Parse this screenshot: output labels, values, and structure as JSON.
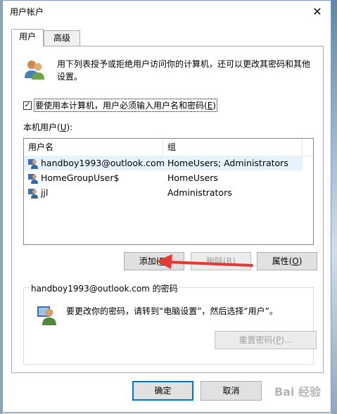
{
  "window": {
    "title": "用户帐户",
    "close_glyph": "✕"
  },
  "tabs": [
    {
      "label": "用户",
      "active": true
    },
    {
      "label": "高级",
      "active": false
    }
  ],
  "intro": {
    "text": "用下列表授予或拒绝用户访问你的计算机，还可以更改其密码和其他设置。"
  },
  "require_password": {
    "checked": true,
    "check_glyph": "✓",
    "label": "要使用本计算机，用户必须输入用户名和密码(",
    "mnemonic": "E",
    "label_end": ")"
  },
  "users_section": {
    "label": "本机用户(",
    "mnemonic": "U",
    "label_end": "):"
  },
  "users_table": {
    "columns": [
      "用户名",
      "组"
    ],
    "rows": [
      {
        "name": "handboy1993@outlook.com",
        "group": "HomeUsers; Administrators",
        "selected": true
      },
      {
        "name": "HomeGroupUser$",
        "group": "HomeUsers",
        "selected": false
      },
      {
        "name": "jjl",
        "group": "Administrators",
        "selected": false
      }
    ]
  },
  "buttons": {
    "add": {
      "label": "添加(",
      "mnemonic": "D",
      "end": ")"
    },
    "remove": {
      "label": "删除(",
      "mnemonic": "R",
      "end": ")"
    },
    "properties": {
      "label": "属性(",
      "mnemonic": "O",
      "end": ")"
    }
  },
  "password_group": {
    "title": "handboy1993@outlook.com 的密码",
    "text": "要更改你的密码，请转到“电脑设置”，然后选择“用户”。",
    "reset_button": {
      "label": "重置密码(",
      "mnemonic": "P",
      "end": ")..."
    }
  },
  "footer": {
    "ok_label": "确定",
    "cancel_label": "取消"
  },
  "watermark": {
    "text": "Bai 经验"
  },
  "colors": {
    "selection": "#e5f3ff",
    "accent": "#0078d7",
    "arrow": "#e53935"
  }
}
